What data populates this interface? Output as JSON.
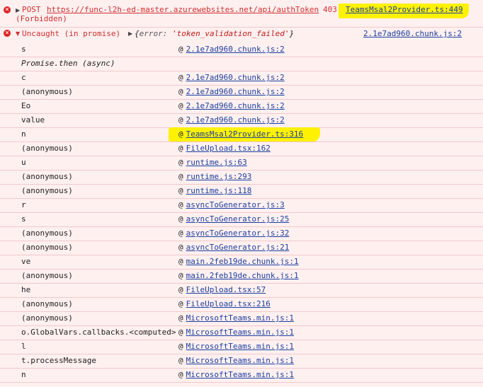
{
  "request": {
    "method": "POST",
    "url": "https://func-l2h-ed-master.azurewebsites.net/api/authToken",
    "status": "403",
    "status_text": "(Forbidden)",
    "source": "TeamsMsal2Provider.ts:449"
  },
  "error": {
    "prefix": "Uncaught (in promise)",
    "object_open": "{",
    "key": "error: ",
    "value": "'token_validation_failed'",
    "object_close": "}",
    "source": "2.1e7ad960.chunk.js:2"
  },
  "stack": [
    {
      "fn": "s",
      "src": "2.1e7ad960.chunk.js:2",
      "highlight": false
    },
    {
      "fn": "Promise.then (async)",
      "src": "",
      "highlight": false,
      "italic": true
    },
    {
      "fn": "c",
      "src": "2.1e7ad960.chunk.js:2",
      "highlight": false
    },
    {
      "fn": "(anonymous)",
      "src": "2.1e7ad960.chunk.js:2",
      "highlight": false
    },
    {
      "fn": "Eo",
      "src": "2.1e7ad960.chunk.js:2",
      "highlight": false
    },
    {
      "fn": "value",
      "src": "2.1e7ad960.chunk.js:2",
      "highlight": false
    },
    {
      "fn": "n",
      "src": "TeamsMsal2Provider.ts:316",
      "highlight": true
    },
    {
      "fn": "(anonymous)",
      "src": "FileUpload.tsx:162",
      "highlight": false
    },
    {
      "fn": "u",
      "src": "runtime.js:63",
      "highlight": false
    },
    {
      "fn": "(anonymous)",
      "src": "runtime.js:293",
      "highlight": false
    },
    {
      "fn": "(anonymous)",
      "src": "runtime.js:118",
      "highlight": false
    },
    {
      "fn": "r",
      "src": "asyncToGenerator.js:3",
      "highlight": false
    },
    {
      "fn": "s",
      "src": "asyncToGenerator.js:25",
      "highlight": false
    },
    {
      "fn": "(anonymous)",
      "src": "asyncToGenerator.js:32",
      "highlight": false
    },
    {
      "fn": "(anonymous)",
      "src": "asyncToGenerator.js:21",
      "highlight": false
    },
    {
      "fn": "ve",
      "src": "main.2feb19de.chunk.js:1",
      "highlight": false
    },
    {
      "fn": "(anonymous)",
      "src": "main.2feb19de.chunk.js:1",
      "highlight": false
    },
    {
      "fn": "he",
      "src": "FileUpload.tsx:57",
      "highlight": false
    },
    {
      "fn": "(anonymous)",
      "src": "FileUpload.tsx:216",
      "highlight": false
    },
    {
      "fn": "(anonymous)",
      "src": "MicrosoftTeams.min.js:1",
      "highlight": false
    },
    {
      "fn": "o.GlobalVars.callbacks.<computed>",
      "src": "MicrosoftTeams.min.js:1",
      "highlight": false
    },
    {
      "fn": "l",
      "src": "MicrosoftTeams.min.js:1",
      "highlight": false
    },
    {
      "fn": "t.processMessage",
      "src": "MicrosoftTeams.min.js:1",
      "highlight": false
    },
    {
      "fn": "n",
      "src": "MicrosoftTeams.min.js:1",
      "highlight": false
    }
  ],
  "at_symbol": "@",
  "colors": {
    "error": "#d32f2f",
    "link": "#1a3fa0",
    "highlight": "#fff200",
    "background": "#fff0f0"
  }
}
